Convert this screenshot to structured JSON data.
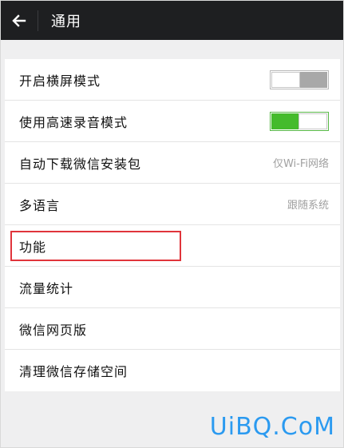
{
  "header": {
    "title": "通用",
    "back_icon": "arrow-left-icon"
  },
  "settings": {
    "items": [
      {
        "label": "开启横屏模式",
        "control": "toggle",
        "state": "off"
      },
      {
        "label": "使用高速录音模式",
        "control": "toggle",
        "state": "on"
      },
      {
        "label": "自动下载微信安装包",
        "value": "仅Wi-Fi网络"
      },
      {
        "label": "多语言",
        "value": "跟随系统"
      },
      {
        "label": "功能",
        "highlighted": true
      },
      {
        "label": "流量统计"
      },
      {
        "label": "微信网页版"
      },
      {
        "label": "清理微信存储空间"
      }
    ]
  },
  "colors": {
    "topbar": "#1e1f21",
    "toggle_on": "#44bb2c",
    "toggle_off": "#a8a8a8",
    "highlight": "#e0343b",
    "watermark": "#2b9af0"
  },
  "watermark": {
    "text": "UiBQ.CoM"
  }
}
